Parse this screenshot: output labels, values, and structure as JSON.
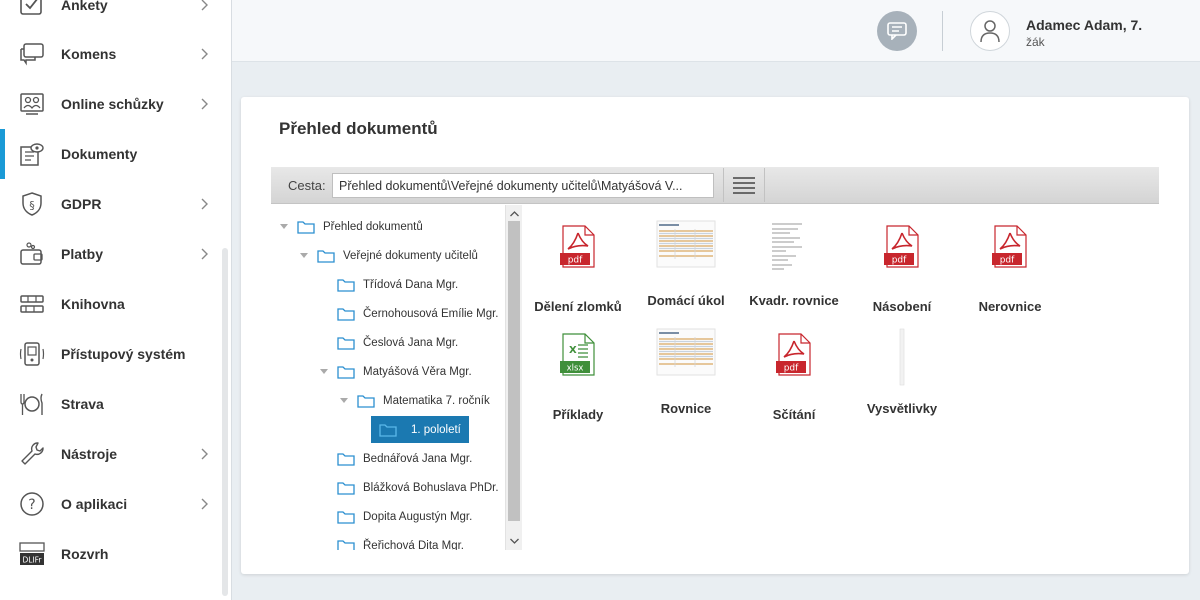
{
  "sidebar": {
    "items": [
      {
        "label": "Ankety",
        "icon": "checkbox-icon",
        "chevron": true
      },
      {
        "label": "Komens",
        "icon": "chat-bubbles-icon",
        "chevron": true
      },
      {
        "label": "Online schůzky",
        "icon": "video-meeting-icon",
        "chevron": true
      },
      {
        "label": "Dokumenty",
        "icon": "documents-icon",
        "chevron": false,
        "active": true
      },
      {
        "label": "GDPR",
        "icon": "shield-paragraph-icon",
        "chevron": true
      },
      {
        "label": "Platby",
        "icon": "wallet-icon",
        "chevron": true
      },
      {
        "label": "Knihovna",
        "icon": "books-icon",
        "chevron": false
      },
      {
        "label": "Přístupový systém",
        "icon": "access-card-icon",
        "chevron": false
      },
      {
        "label": "Strava",
        "icon": "cutlery-icon",
        "chevron": false
      },
      {
        "label": "Nástroje",
        "icon": "wrench-icon",
        "chevron": true
      },
      {
        "label": "O aplikaci",
        "icon": "question-icon",
        "chevron": true
      },
      {
        "label": "Rozvrh",
        "icon": "timetable-icon",
        "chevron": false,
        "icon_text": "DLIFr"
      }
    ]
  },
  "header": {
    "user_name": "Adamec Adam, 7.",
    "user_role": "žák"
  },
  "panel": {
    "title": "Přehled dokumentů",
    "path_label": "Cesta:",
    "path_value": "Přehled dokumentů\\Veřejné dokumenty učitelů\\Matyášová V..."
  },
  "tree": [
    {
      "label": "Přehled dokumentů",
      "level": 0,
      "expanded": true
    },
    {
      "label": "Veřejné dokumenty učitelů",
      "level": 1,
      "expanded": true
    },
    {
      "label": "Třídová Dana Mgr.",
      "level": 2
    },
    {
      "label": "Černohousová Emílie Mgr.",
      "level": 2
    },
    {
      "label": "Česlová Jana Mgr.",
      "level": 2
    },
    {
      "label": "Matyášová Věra Mgr.",
      "level": 2,
      "expanded": true
    },
    {
      "label": "Matematika 7. ročník",
      "level": 3,
      "expanded": true
    },
    {
      "label": "1. pololetí",
      "level": 4,
      "selected": true
    },
    {
      "label": "Bednářová Jana Mgr.",
      "level": 2
    },
    {
      "label": "Blážková Bohuslava PhDr.",
      "level": 2
    },
    {
      "label": "Dopita Augustýn Mgr.",
      "level": 2
    },
    {
      "label": "Řeřichová Dita Mgr.",
      "level": 2
    }
  ],
  "files": [
    {
      "name": "Dělení zlomků",
      "type": "pdf",
      "badge": "pdf"
    },
    {
      "name": "Domácí úkol",
      "type": "sheet-thumb"
    },
    {
      "name": "Kvadr. rovnice",
      "type": "doc-thumb"
    },
    {
      "name": "Násobení",
      "type": "pdf",
      "badge": "pdf"
    },
    {
      "name": "Nerovnice",
      "type": "pdf",
      "badge": "pdf"
    },
    {
      "name": "Příklady",
      "type": "xlsx",
      "badge": "xlsx"
    },
    {
      "name": "Rovnice",
      "type": "sheet-thumb"
    },
    {
      "name": "Sčítání",
      "type": "pdf",
      "badge": "pdf"
    },
    {
      "name": "Vysvětlivky",
      "type": "thin-thumb"
    }
  ],
  "colors": {
    "accent": "#1a9ad6",
    "selected": "#1b79b1",
    "pdf": "#c8262d",
    "xlsx": "#3f8f3a",
    "folder": "#2b8fd0"
  }
}
